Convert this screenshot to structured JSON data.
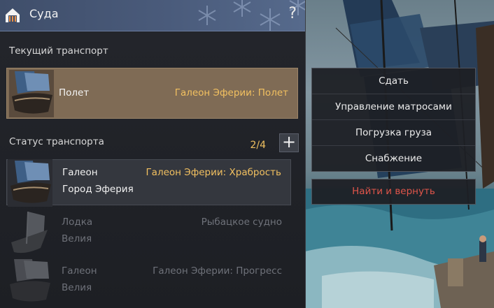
{
  "window": {
    "title": "Суда",
    "help_label": "?"
  },
  "colors": {
    "accent": "#f2c060",
    "danger": "#e0554a",
    "selected_card": "#7f6b55",
    "titlebar": "#4a5b7b"
  },
  "current_transport": {
    "label": "Текущий транспорт",
    "type": "Полет",
    "name": "Галеон Эферии: Полет",
    "icon": "galleon-thumbnail"
  },
  "transport_status": {
    "label": "Статус транспорта",
    "count": "2/4",
    "add_label": "+",
    "vessels": [
      {
        "type": "Галеон",
        "name": "Галеон Эферии: Храбрость",
        "location": "Город Эферия",
        "state": "active",
        "icon": "galleon-thumbnail"
      },
      {
        "type": "Лодка",
        "name": "Рыбацкое судно",
        "location": "Велия",
        "state": "inactive",
        "icon": "boat-thumbnail"
      },
      {
        "type": "Галеон",
        "name": "Галеон Эферии: Прогресс",
        "location": "Велия",
        "state": "inactive",
        "icon": "galleon-thumbnail"
      }
    ]
  },
  "context_menu": {
    "items": [
      "Сдать",
      "Управление матросами",
      "Погрузка груза",
      "Снабжение"
    ],
    "danger_action": "Найти и вернуть"
  }
}
